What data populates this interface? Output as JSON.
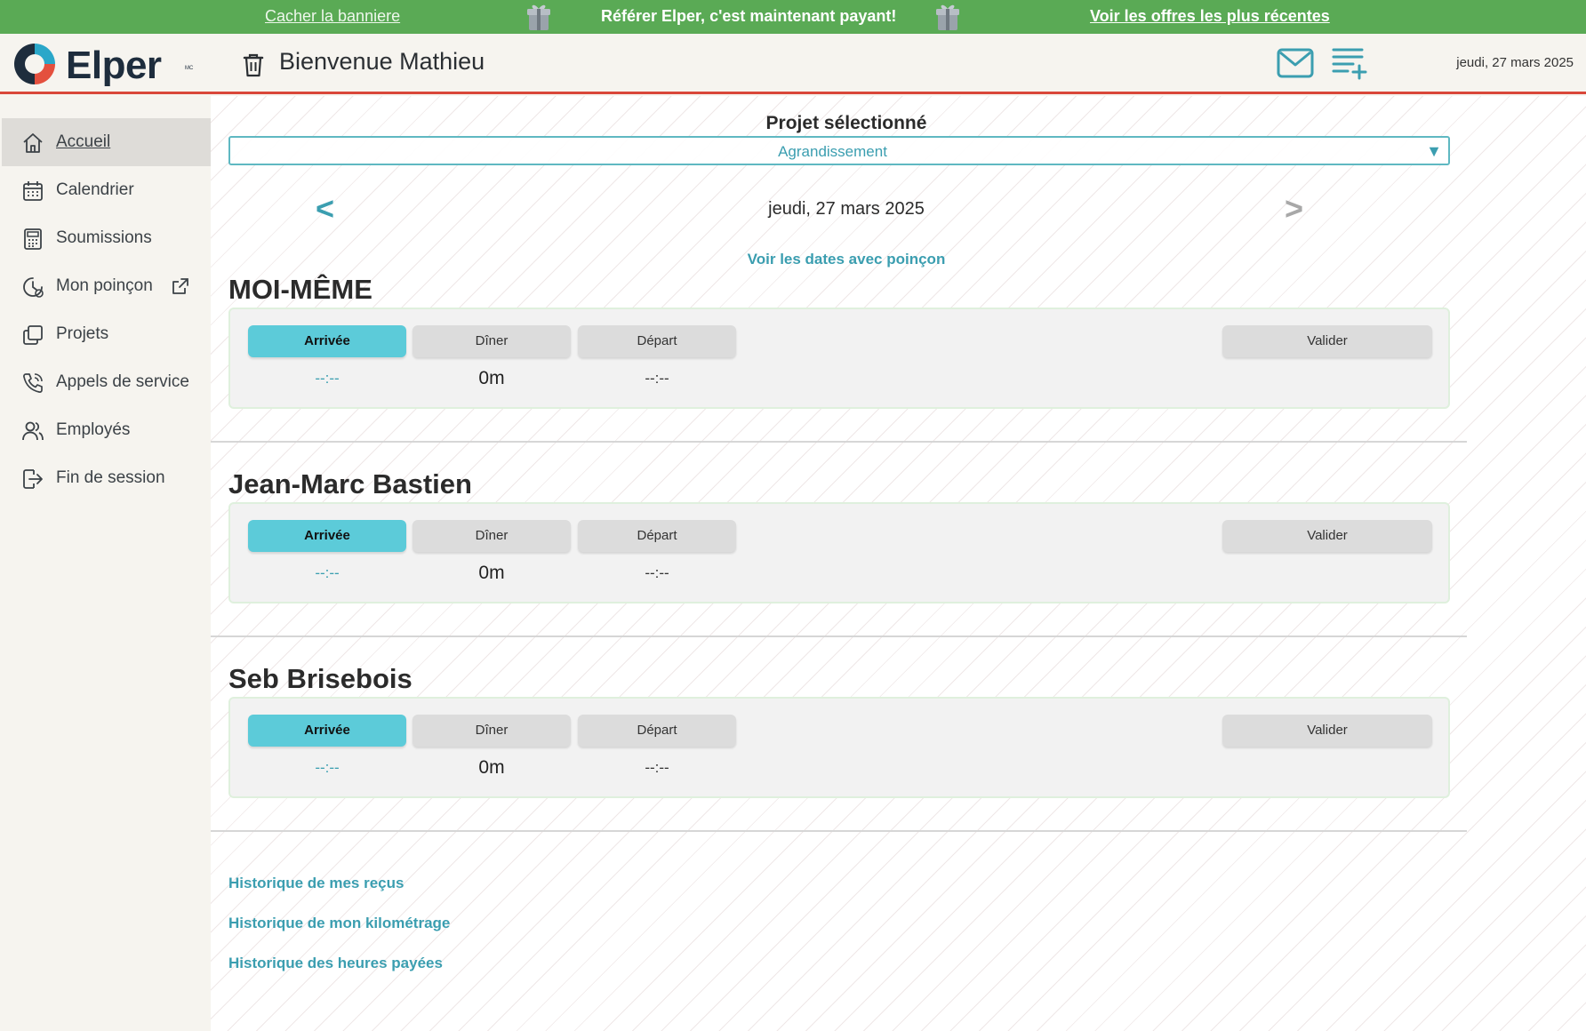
{
  "banner": {
    "hide_label": "Cacher la banniere",
    "promo_text": "Référer Elper, c'est maintenant payant!",
    "offers_label": "Voir les offres les plus récentes",
    "gift_icon": "gift-icon"
  },
  "header": {
    "logo_text": "Elper",
    "logo_mark": "MC",
    "welcome": "Bienvenue Mathieu",
    "date": "jeudi, 27 mars 2025"
  },
  "sidebar": {
    "items": [
      {
        "label": "Accueil",
        "icon": "home-icon",
        "active": true
      },
      {
        "label": "Calendrier",
        "icon": "calendar-icon"
      },
      {
        "label": "Soumissions",
        "icon": "calculator-icon"
      },
      {
        "label": "Mon poinçon",
        "icon": "clock-icon",
        "external": true
      },
      {
        "label": "Projets",
        "icon": "copy-icon"
      },
      {
        "label": "Appels de service",
        "icon": "phone-icon"
      },
      {
        "label": "Employés",
        "icon": "users-icon"
      },
      {
        "label": "Fin de session",
        "icon": "logout-icon"
      }
    ]
  },
  "main": {
    "project_label": "Projet sélectionné",
    "project_value": "Agrandissement",
    "prev": "<",
    "next": ">",
    "current_date": "jeudi, 27 mars 2025",
    "punch_dates_link": "Voir les dates avec poinçon",
    "buttons": {
      "arrive": "Arrivée",
      "lunch": "Dîner",
      "depart": "Départ",
      "validate": "Valider"
    },
    "employees": [
      {
        "name": "MOI-MÊME",
        "arrive": "--:--",
        "lunch": "0m",
        "depart": "--:--"
      },
      {
        "name": "Jean-Marc Bastien",
        "arrive": "--:--",
        "lunch": "0m",
        "depart": "--:--"
      },
      {
        "name": "Seb Brisebois",
        "arrive": "--:--",
        "lunch": "0m",
        "depart": "--:--"
      }
    ],
    "history_links": [
      "Historique de mes reçus",
      "Historique de mon kilométrage",
      "Historique des heures payées"
    ]
  },
  "colors": {
    "banner": "#5aaa55",
    "accent": "#3b9eb0",
    "arrive_button": "#5ccbd9",
    "header_rule": "#d9473a"
  }
}
